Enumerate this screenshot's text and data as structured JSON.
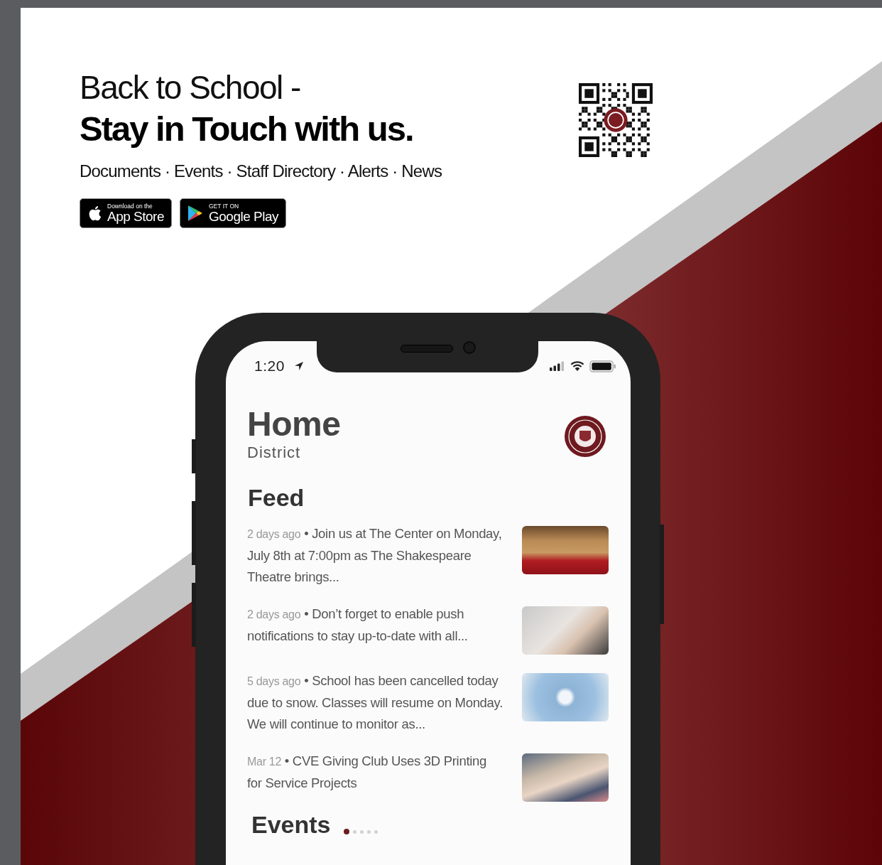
{
  "poster": {
    "title_line1": "Back to School -",
    "title_line2": "Stay in Touch with us.",
    "features": "Documents · Events · Staff Directory · Alerts · News",
    "store_badges": [
      {
        "kind": "apple",
        "caption": "Download on the",
        "label": "App Store"
      },
      {
        "kind": "google",
        "caption": "GET IT ON",
        "label": "Google Play"
      }
    ]
  },
  "phone": {
    "status_bar": {
      "time": "1:20"
    },
    "header": {
      "title": "Home",
      "subtitle": "District"
    },
    "feed": {
      "heading": "Feed",
      "items": [
        {
          "date": "2 days ago",
          "text": "• Join us at The Center on Monday, July 8th at 7:00pm as The Shakespeare Theatre brings..."
        },
        {
          "date": "2 days ago",
          "text": "• Don’t forget to enable push notifications to stay up-to-date with all..."
        },
        {
          "date": "5 days ago",
          "text": "• School has been cancelled today due to snow. Classes will resume on Monday. We will continue to monitor as..."
        },
        {
          "date": "Mar 12",
          "text": "• CVE Giving Club Uses 3D Printing for Service Projects"
        }
      ]
    },
    "events": {
      "heading": "Events",
      "pages": [
        {
          "selected": true
        },
        {
          "selected": false
        },
        {
          "selected": false
        },
        {
          "selected": false
        },
        {
          "selected": false
        }
      ]
    }
  }
}
